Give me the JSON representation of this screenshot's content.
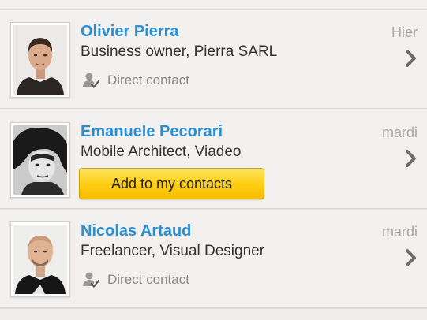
{
  "contacts": [
    {
      "name": "Olivier Pierra",
      "title": "Business owner, Pierra SARL",
      "date": "Hier",
      "status": "Direct contact",
      "status_icon": "direct-contact-icon"
    },
    {
      "name": "Emanuele Pecorari",
      "title": "Mobile Architect, Viadeo",
      "date": "mardi",
      "action_label": "Add to my contacts"
    },
    {
      "name": "Nicolas Artaud",
      "title": "Freelancer, Visual Designer",
      "date": "mardi",
      "status": "Direct contact",
      "status_icon": "direct-contact-icon"
    }
  ],
  "colors": {
    "name": "#2a8ed3",
    "button": "#ffcc10",
    "date": "#a9a8a6"
  },
  "icons": {
    "chevron": "chevron-right-icon",
    "status": "direct-contact-icon"
  }
}
